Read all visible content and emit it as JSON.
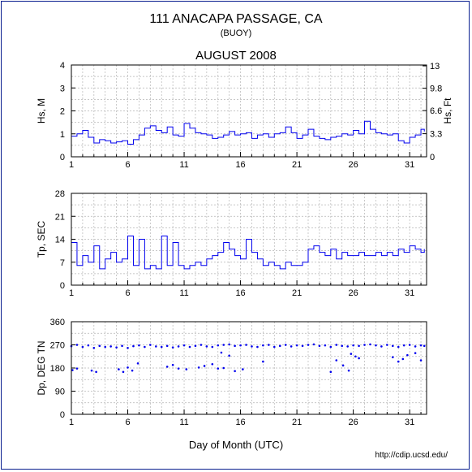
{
  "page": {
    "title": "111 ANACAPA PASSAGE, CA",
    "subtitle": "(BUOY)",
    "month_title": "AUGUST 2008",
    "xlabel": "Day of Month (UTC)",
    "url": "http://cdip.ucsd.edu/"
  },
  "colors": {
    "series": "#0000ee",
    "frame": "#0a1f8f",
    "grid": "#b5b5b5"
  },
  "chart_data": [
    {
      "type": "line",
      "ylabel": "Hs, M",
      "ylabel_right": "Hs, Ft",
      "ylim": [
        0,
        4
      ],
      "yticks": [
        0,
        1,
        2,
        3,
        4
      ],
      "yticks_right": [
        {
          "label": "0",
          "value": 0
        },
        {
          "label": "3.3",
          "value": 1.006
        },
        {
          "label": "6.6",
          "value": 2.012
        },
        {
          "label": "9.8",
          "value": 2.987
        },
        {
          "label": "13",
          "value": 3.962
        }
      ],
      "xlim": [
        1,
        32.5
      ],
      "xticks": [
        1,
        6,
        11,
        16,
        21,
        26,
        31
      ],
      "grid": true,
      "x": [
        1,
        1.5,
        2,
        2.5,
        3,
        3.5,
        4,
        4.5,
        5,
        5.5,
        6,
        6.5,
        7,
        7.5,
        8,
        8.5,
        9,
        9.5,
        10,
        10.5,
        11,
        11.5,
        12,
        12.5,
        13,
        13.5,
        14,
        14.5,
        15,
        15.5,
        16,
        16.5,
        17,
        17.5,
        18,
        18.5,
        19,
        19.5,
        20,
        20.5,
        21,
        21.5,
        22,
        22.5,
        23,
        23.5,
        24,
        24.5,
        25,
        25.5,
        26,
        26.5,
        27,
        27.5,
        28,
        28.5,
        29,
        29.5,
        30,
        30.5,
        31,
        31.5,
        32,
        32.3
      ],
      "y": [
        0.9,
        1.0,
        1.15,
        0.85,
        0.6,
        0.75,
        0.7,
        0.6,
        0.65,
        0.7,
        0.55,
        0.75,
        0.95,
        1.25,
        1.35,
        1.15,
        1.05,
        1.3,
        0.95,
        0.9,
        1.45,
        1.25,
        1.05,
        1.0,
        0.95,
        0.8,
        0.85,
        0.95,
        1.1,
        0.95,
        1.0,
        1.05,
        0.8,
        0.95,
        1.0,
        0.85,
        1.0,
        1.05,
        1.3,
        1.05,
        0.8,
        0.95,
        1.2,
        0.9,
        0.8,
        0.75,
        0.85,
        0.9,
        1.0,
        0.95,
        1.15,
        1.0,
        1.55,
        1.2,
        1.05,
        1.0,
        0.95,
        1.0,
        0.7,
        0.6,
        0.85,
        0.95,
        1.2,
        1.1
      ]
    },
    {
      "type": "line",
      "ylabel": "Tp, SEC",
      "ylim": [
        0,
        28
      ],
      "yticks": [
        0,
        7,
        14,
        21,
        28
      ],
      "xlim": [
        1,
        32.5
      ],
      "xticks": [
        1,
        6,
        11,
        16,
        21,
        26,
        31
      ],
      "grid": true,
      "x": [
        1,
        1.5,
        2,
        2.5,
        3,
        3.5,
        4,
        4.5,
        5,
        5.5,
        6,
        6.5,
        7,
        7.5,
        8,
        8.5,
        9,
        9.5,
        10,
        10.5,
        11,
        11.5,
        12,
        12.5,
        13,
        13.5,
        14,
        14.5,
        15,
        15.5,
        16,
        16.5,
        17,
        17.5,
        18,
        18.5,
        19,
        19.5,
        20,
        20.5,
        21,
        21.5,
        22,
        22.5,
        23,
        23.5,
        24,
        24.5,
        25,
        25.5,
        26,
        26.5,
        27,
        27.5,
        28,
        28.5,
        29,
        29.5,
        30,
        30.5,
        31,
        31.5,
        32,
        32.3
      ],
      "y": [
        13,
        6,
        9,
        7,
        12,
        5,
        8,
        10,
        7,
        8,
        15,
        6,
        14,
        5,
        6,
        5,
        15,
        6,
        13,
        6,
        5,
        6,
        7,
        6,
        8,
        9,
        10,
        13,
        11,
        9,
        8,
        14,
        10,
        8,
        6,
        7,
        6,
        5,
        7,
        6,
        6,
        7,
        11,
        12,
        10,
        9,
        11,
        8,
        10,
        9,
        9,
        10,
        9,
        9,
        10,
        9,
        10,
        9,
        11,
        10,
        12,
        11,
        10,
        11
      ]
    },
    {
      "type": "scatter",
      "ylabel": "Dp, DEG TN",
      "ylim": [
        0,
        360
      ],
      "yticks": [
        0,
        90,
        180,
        270,
        360
      ],
      "xlim": [
        1,
        32.5
      ],
      "xticks": [
        1,
        6,
        11,
        16,
        21,
        26,
        31
      ],
      "grid": true,
      "x": [
        1,
        1.5,
        2,
        2.5,
        3,
        3.5,
        4,
        4.5,
        5,
        5.5,
        6,
        6.5,
        7,
        7.5,
        8,
        8.5,
        9,
        9.5,
        10,
        10.5,
        11,
        11.5,
        12,
        12.5,
        13,
        13.5,
        14,
        14.5,
        15,
        15.5,
        16,
        16.5,
        17,
        17.5,
        18,
        18.5,
        19,
        19.5,
        20,
        20.5,
        21,
        21.5,
        22,
        22.5,
        23,
        23.5,
        24,
        24.5,
        25,
        25.5,
        26,
        26.5,
        27,
        27.5,
        28,
        28.5,
        29,
        29.5,
        30,
        30.5,
        31,
        31.5,
        32,
        32.3,
        1.1,
        1.5,
        2.8,
        3.2,
        5.2,
        5.6,
        6.0,
        6.4,
        6.9,
        9.5,
        10.0,
        10.5,
        11.2,
        12.3,
        12.8,
        13.5,
        14.0,
        14.5,
        15.5,
        16.2,
        18.0,
        24.0,
        24.5,
        25.1,
        25.6,
        26.2,
        30.0,
        30.4,
        30.8,
        31.5,
        32.0,
        14.3,
        15.0,
        25.8,
        26.5,
        29.5
      ],
      "y": [
        265,
        270,
        262,
        268,
        258,
        266,
        262,
        264,
        260,
        266,
        258,
        265,
        268,
        262,
        270,
        264,
        262,
        266,
        260,
        264,
        268,
        262,
        266,
        270,
        264,
        262,
        268,
        270,
        272,
        266,
        268,
        270,
        264,
        262,
        268,
        270,
        262,
        266,
        270,
        264,
        268,
        266,
        270,
        272,
        266,
        268,
        262,
        270,
        266,
        264,
        268,
        266,
        270,
        272,
        268,
        264,
        270,
        266,
        262,
        268,
        270,
        264,
        268,
        266,
        172,
        178,
        170,
        165,
        175,
        165,
        182,
        170,
        198,
        185,
        192,
        178,
        175,
        182,
        188,
        195,
        178,
        180,
        168,
        175,
        205,
        165,
        210,
        190,
        170,
        225,
        205,
        215,
        230,
        238,
        210,
        240,
        228,
        235,
        218,
        222
      ]
    }
  ]
}
